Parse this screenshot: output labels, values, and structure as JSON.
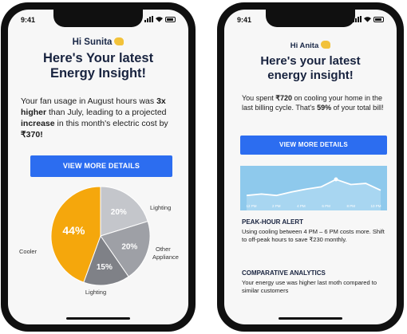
{
  "left_phone": {
    "status_time": "9:41",
    "greeting": "Hi Sunita",
    "headline_line1": "Here's Your latest",
    "headline_line2": "Energy Insight!",
    "message": {
      "p1": "Your fan usage in August hours was ",
      "b1": "3x higher",
      "p2": " than July, leading to a projected ",
      "b2": "increase",
      "p3": " in this month's electric cost by ",
      "b3": "₹370!"
    },
    "cta_label": "VIEW MORE DETAILS",
    "chart_data": {
      "type": "pie",
      "slices": [
        {
          "label": "Lighting",
          "value": 20,
          "pct_label": "20%",
          "color": "#c4c6cb"
        },
        {
          "label": "Other Appliance",
          "value": 20,
          "pct_label": "20%",
          "color": "#9ea0a6"
        },
        {
          "label": "Lighting",
          "value": 15,
          "pct_label": "15%",
          "color": "#7f8187"
        },
        {
          "label": "Cooler",
          "value": 44,
          "pct_label": "44%",
          "color": "#f5a70c"
        }
      ],
      "label_other_line1": "Other",
      "label_other_line2": "Appliance"
    }
  },
  "right_phone": {
    "status_time": "9:41",
    "greeting": "Hi Anita",
    "headline_line1": "Here's your latest",
    "headline_line2": "energy insight!",
    "message": {
      "p1": "You spent ",
      "b1": "₹720",
      "p2": " on cooling your home in the last billing cycle. That's ",
      "b2": "59%",
      "p3": " of your total bill!"
    },
    "cta_label": "VIEW MORE DETAILS",
    "mini_chart": {
      "type": "area",
      "values": [
        0.3,
        0.35,
        0.3,
        0.42,
        0.52,
        0.6,
        0.86,
        0.68,
        0.72,
        0.48
      ],
      "x_labels": [
        "12 PM",
        "2 PM",
        "4 PM",
        "6 PM",
        "8 PM",
        "10 PM"
      ],
      "fill_color": "#8ec9ec"
    },
    "peak_title": "PEAK-HOUR ALERT",
    "peak_text": "Using cooling between 4 PM – 6 PM costs more. Shift to off-peak hours to save ₹230 monthly.",
    "comparative_title": "COMPARATIVE ANALYTICS",
    "comparative_text": "Your energy use was higher last moth compared to similar customers"
  },
  "colors": {
    "accent": "#2c6df0",
    "cooler": "#f5a70c",
    "headline": "#18233f"
  }
}
